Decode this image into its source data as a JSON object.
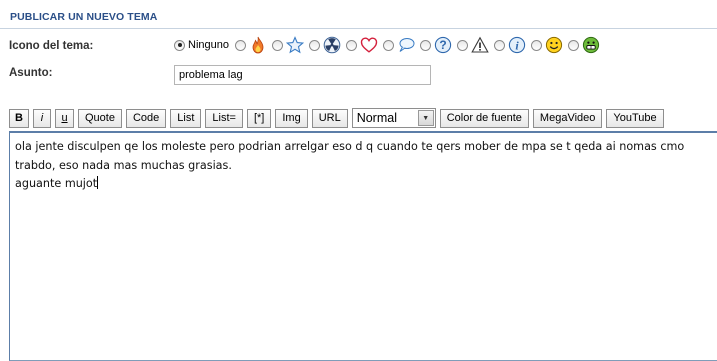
{
  "header": {
    "title": "PUBLICAR UN NUEVO TEMA"
  },
  "topic_icon": {
    "label": "Icono del tema:",
    "options": [
      {
        "label": "Ninguno",
        "checked": true
      },
      {
        "icon": "flame-icon",
        "checked": false
      },
      {
        "icon": "star-icon",
        "checked": false
      },
      {
        "icon": "radioactive-icon",
        "checked": false
      },
      {
        "icon": "heart-icon",
        "checked": false
      },
      {
        "icon": "speech-bubble-icon",
        "checked": false
      },
      {
        "icon": "question-icon",
        "checked": false
      },
      {
        "icon": "warning-icon",
        "checked": false
      },
      {
        "icon": "info-icon",
        "checked": false
      },
      {
        "icon": "smiley-icon",
        "checked": false
      },
      {
        "icon": "grin-icon",
        "checked": false
      }
    ]
  },
  "subject": {
    "label": "Asunto:",
    "value": "problema lag"
  },
  "toolbar": {
    "bold": "B",
    "italic": "i",
    "underline": "u",
    "quote": "Quote",
    "code": "Code",
    "list": "List",
    "list_eq": "List=",
    "list_item": "[*]",
    "img": "Img",
    "url": "URL",
    "size_select": "Normal",
    "font_color": "Color de fuente",
    "megavideo": "MegaVideo",
    "youtube": "YouTube"
  },
  "editor": {
    "line1": "ola jente disculpen qe los moleste pero podrian arrelgar eso d q cuando te qers mober de mpa se t qeda ai nomas cmo",
    "line2": "trabdo, eso nada mas muchas grasias.",
    "line3": "aguante mujot"
  },
  "colors": {
    "header_text": "#2b4f88",
    "editor_border": "#5c7ea8"
  }
}
